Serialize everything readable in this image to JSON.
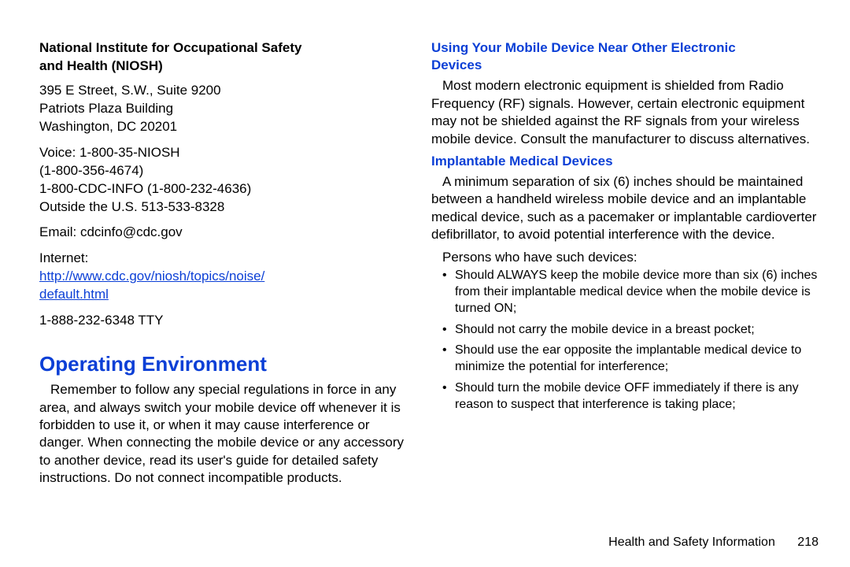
{
  "left": {
    "org_title_l1": "National Institute for Occupational Safety",
    "org_title_l2": "and Health (NIOSH)",
    "addr1": "395 E Street, S.W., Suite 9200",
    "addr2": "Patriots Plaza Building",
    "addr3": "Washington, DC 20201",
    "voice1": "Voice: 1-800-35-NIOSH",
    "voice2": "(1-800-356-4674)",
    "voice3": "1-800-CDC-INFO (1-800-232-4636)",
    "voice4": "Outside the U.S. 513-533-8328",
    "email": "Email: cdcinfo@cdc.gov",
    "internet_label": "Internet:",
    "internet_link_l1": "http://www.cdc.gov/niosh/topics/noise/",
    "internet_link_l2": "default.html",
    "tty": "1-888-232-6348 TTY",
    "section_heading": "Operating Environment",
    "section_para": "Remember to follow any special regulations in force in any area, and always switch your mobile device off whenever it is forbidden to use it, or when it may cause interference or danger. When connecting the mobile device or any accessory to another device, read its user's guide for detailed safety instructions. Do not connect incompatible products."
  },
  "right": {
    "sub1_l1": "Using Your Mobile Device Near Other Electronic",
    "sub1_l2": "Devices",
    "para1": "Most modern electronic equipment is shielded from Radio Frequency (RF) signals. However, certain electronic equipment may not be shielded against the RF signals from your wireless mobile device. Consult the manufacturer to discuss alternatives.",
    "sub2": "Implantable Medical Devices",
    "para2": "A minimum separation of six (6) inches should be maintained between a handheld wireless mobile device and an implantable medical device, such as a pacemaker or implantable cardioverter defibrillator, to avoid potential interference with the device.",
    "para3": "Persons who have such devices:",
    "bullets": [
      "Should ALWAYS keep the mobile device more than six (6) inches from their implantable medical device when the mobile device is turned ON;",
      "Should not carry the mobile device in a breast pocket;",
      "Should use the ear opposite the implantable medical device to minimize the potential for interference;",
      "Should turn the mobile device OFF immediately if there is any reason to suspect that interference is taking place;"
    ]
  },
  "footer": {
    "label": "Health and Safety Information",
    "page": "218"
  }
}
